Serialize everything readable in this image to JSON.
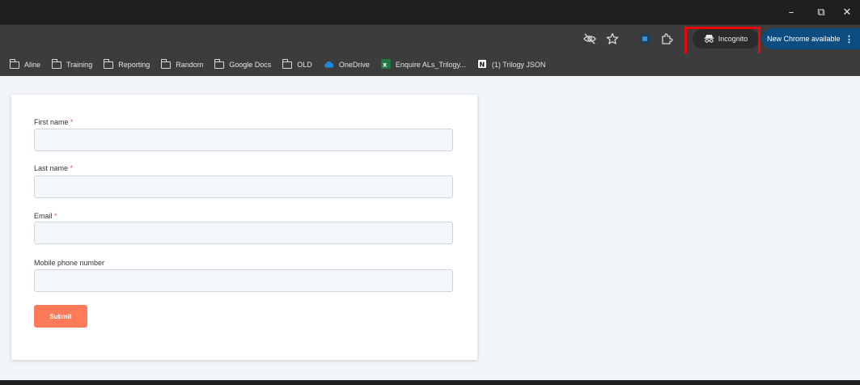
{
  "browser": {
    "window_controls": {
      "minimize": "–",
      "restore": "⧉",
      "close": "✕"
    },
    "toolbar": {
      "incognito_label": "Incognito",
      "update_label": "New Chrome available"
    },
    "bookmarks": [
      {
        "label": "Aline",
        "icon": "folder-icon"
      },
      {
        "label": "Training",
        "icon": "folder-icon"
      },
      {
        "label": "Reporting",
        "icon": "folder-icon"
      },
      {
        "label": "Random",
        "icon": "folder-icon"
      },
      {
        "label": "Google Docs",
        "icon": "folder-icon"
      },
      {
        "label": "OLD",
        "icon": "folder-icon"
      },
      {
        "label": "OneDrive",
        "icon": "onedrive-icon"
      },
      {
        "label": "Enquire ALs_Trilogy...",
        "icon": "excel-icon"
      },
      {
        "label": "(1) Trilogy JSON",
        "icon": "notion-icon"
      }
    ]
  },
  "form": {
    "fields": [
      {
        "label": "First name",
        "required_mark": "*",
        "value": ""
      },
      {
        "label": "Last name",
        "required_mark": "*",
        "value": ""
      },
      {
        "label": "Email",
        "required_mark": "*",
        "value": ""
      },
      {
        "label": "Mobile phone number",
        "required_mark": "",
        "value": ""
      }
    ],
    "submit_label": "Submit"
  },
  "colors": {
    "accent_submit": "#ff7a59",
    "highlight_box": "#e8080a",
    "update_button": "#0b4d80"
  }
}
